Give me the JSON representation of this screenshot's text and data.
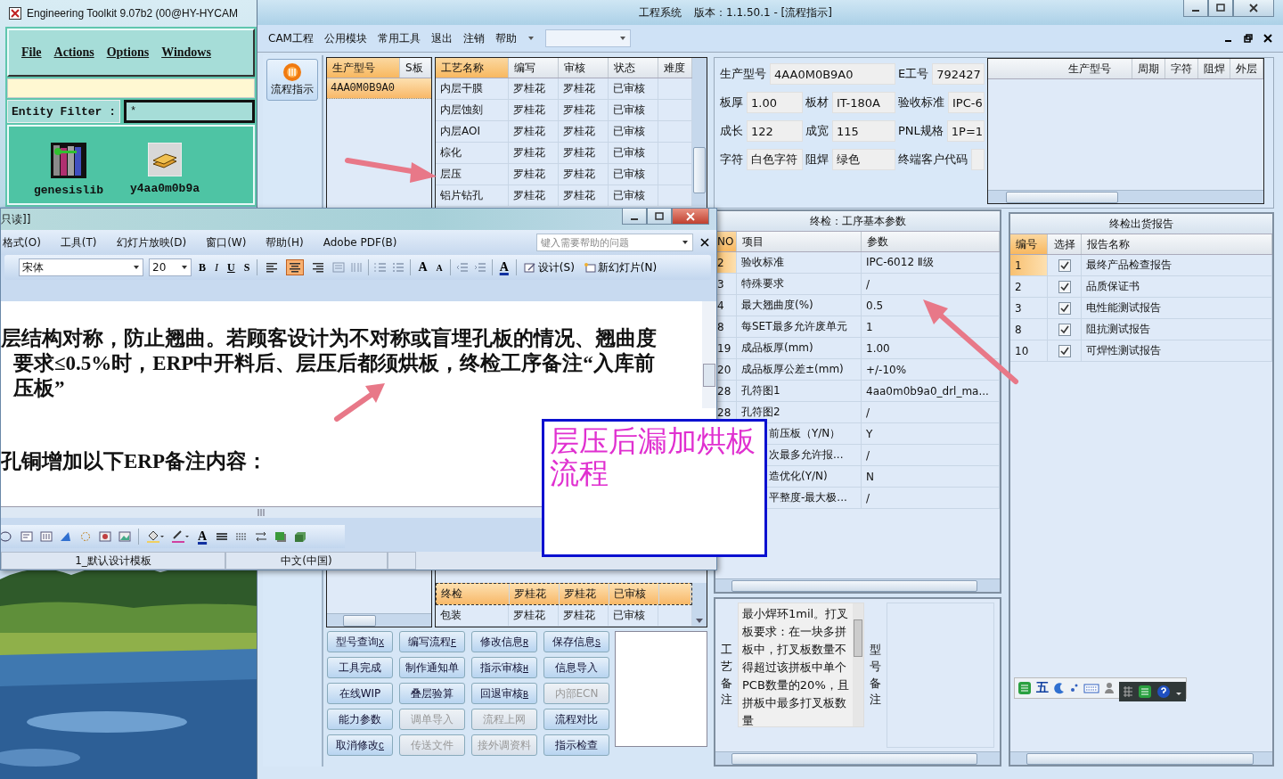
{
  "genesis_window": {
    "title": "Engineering Toolkit 9.07b2 (00@HY-HYCAM",
    "menu": [
      "File",
      "Actions",
      "Options",
      "Windows"
    ],
    "entity_filter": {
      "label": "Entity Filter :",
      "value": "*"
    },
    "entities": [
      {
        "name": "genesislib",
        "kind": "library"
      },
      {
        "name": "y4aa0m0b9a",
        "kind": "job"
      }
    ]
  },
  "main_window": {
    "title": "工程系统",
    "version": "版本：1.1.50.1 - [流程指示]",
    "menu": [
      "CAM工程",
      "公用模块",
      "常用工具",
      "退出",
      "注销",
      "帮助"
    ],
    "nav": [
      {
        "label": "流程指示",
        "selected": true
      }
    ],
    "model_list": {
      "columns": [
        "生产型号",
        "S板"
      ],
      "rows": [
        {
          "model": "4AA0M0B9A0",
          "selected": true
        }
      ]
    },
    "process_table": {
      "columns": [
        "工艺名称",
        "编写",
        "审核",
        "状态",
        "难度"
      ],
      "rows": [
        {
          "name": "内层干膜",
          "writer": "罗桂花",
          "reviewer": "罗桂花",
          "status": "已审核",
          "selected": false
        },
        {
          "name": "内层蚀刻",
          "writer": "罗桂花",
          "reviewer": "罗桂花",
          "status": "已审核",
          "selected": false
        },
        {
          "name": "内层AOI",
          "writer": "罗桂花",
          "reviewer": "罗桂花",
          "status": "已审核",
          "selected": false
        },
        {
          "name": "棕化",
          "writer": "罗桂花",
          "reviewer": "罗桂花",
          "status": "已审核",
          "selected": false
        },
        {
          "name": "层压",
          "writer": "罗桂花",
          "reviewer": "罗桂花",
          "status": "已审核",
          "selected": false
        },
        {
          "name": "铝片钻孔",
          "writer": "罗桂花",
          "reviewer": "罗桂花",
          "status": "已审核",
          "selected": false
        }
      ],
      "rows_lower": [
        {
          "name": "终检",
          "writer": "罗桂花",
          "reviewer": "罗桂花",
          "status": "已审核",
          "selected": true
        },
        {
          "name": "包装",
          "writer": "罗桂花",
          "reviewer": "罗桂花",
          "status": "已审核",
          "selected": false
        }
      ]
    },
    "info": {
      "fields": [
        {
          "kind": "wide",
          "label": "生产型号",
          "value": "4AA0M0B9A0"
        },
        {
          "kind": "normal",
          "label": "E工号",
          "value": "792427"
        },
        {
          "kind": "normal",
          "label": "板厚",
          "value": "1.00"
        },
        {
          "kind": "normal",
          "label": "板材",
          "value": "IT-180A"
        },
        {
          "kind": "normal",
          "label": "验收标准",
          "value": "IPC-6"
        },
        {
          "kind": "normal",
          "label": "成长",
          "value": "122"
        },
        {
          "kind": "normal",
          "label": "成宽",
          "value": "115"
        },
        {
          "kind": "normal",
          "label": "PNL规格",
          "value": "1P=1"
        },
        {
          "kind": "normal",
          "label": "字符",
          "value": "白色字符"
        },
        {
          "kind": "normal",
          "label": "阻焊",
          "value": "绿色"
        },
        {
          "kind": "normal",
          "label": "终端客户代码"
        }
      ]
    },
    "lookup_table": {
      "columns": [
        "生产型号",
        "周期",
        "字符",
        "阻焊",
        "外层"
      ]
    },
    "params": {
      "title": "终检：工序基本参数",
      "columns": [
        "NO",
        "项目",
        "参数"
      ],
      "rows": [
        {
          "no": "2",
          "item": "验收标准",
          "value": "IPC-6012 Ⅱ级",
          "selected": true
        },
        {
          "no": "3",
          "item": "特殊要求",
          "value": "/",
          "selected": false
        },
        {
          "no": "4",
          "item": "最大翘曲度(%)",
          "value": "0.5",
          "selected": false
        },
        {
          "no": "8",
          "item": "每SET最多允许废单元",
          "value": "1",
          "selected": false
        },
        {
          "no": "19",
          "item": "成品板厚(mm)",
          "value": "1.00",
          "selected": false
        },
        {
          "no": "20",
          "item": "成品板厚公差±(mm)",
          "value": "+/-10%",
          "selected": false
        },
        {
          "no": "28",
          "item": "孔符图1",
          "value": "4aa0m0b9a0_drl_ma...",
          "selected": false
        },
        {
          "no": "28",
          "item": "孔符图2",
          "value": "/",
          "selected": false
        },
        {
          "item": "前压板（Y/N）",
          "value": "Y"
        },
        {
          "item": "次最多允许报...",
          "value": "/"
        },
        {
          "item": "造优化(Y/N)",
          "value": "N"
        },
        {
          "item": "平整度-最大极...",
          "value": "/"
        }
      ]
    },
    "report": {
      "title": "终检出货报告",
      "columns": [
        "编号",
        "选择",
        "报告名称"
      ],
      "rows": [
        {
          "no": "1",
          "checked": true,
          "name": "最终产品检查报告",
          "selected": true
        },
        {
          "no": "2",
          "checked": true,
          "name": "品质保证书",
          "selected": false
        },
        {
          "no": "3",
          "checked": true,
          "name": "电性能测试报告",
          "selected": false
        },
        {
          "no": "8",
          "checked": true,
          "name": "阻抗测试报告",
          "selected": false
        },
        {
          "no": "10",
          "checked": true,
          "name": "可焊性测试报告",
          "selected": false
        }
      ]
    },
    "buttons": [
      {
        "label": "型号查询",
        "hotkey": "X",
        "disabled": false
      },
      {
        "label": "编写流程",
        "hotkey": "F",
        "disabled": false
      },
      {
        "label": "修改信息",
        "hotkey": "R",
        "disabled": false
      },
      {
        "label": "保存信息",
        "hotkey": "S",
        "disabled": false
      },
      {
        "label": "工具完成",
        "disabled": false
      },
      {
        "label": "制作通知单",
        "disabled": false
      },
      {
        "label": "指示审核",
        "hotkey": "H",
        "disabled": false
      },
      {
        "label": "信息导入",
        "disabled": false
      },
      {
        "label": "在线WIP",
        "disabled": false
      },
      {
        "label": "叠层验算",
        "disabled": false
      },
      {
        "label": "回退审核",
        "hotkey": "B",
        "disabled": false
      },
      {
        "label": "内部ECN",
        "disabled": true
      },
      {
        "label": "能力参数",
        "disabled": false
      },
      {
        "label": "调单导入",
        "disabled": true
      },
      {
        "label": "流程上网",
        "disabled": true
      },
      {
        "label": "流程对比",
        "disabled": false
      },
      {
        "label": "取消修改",
        "hotkey": "C",
        "disabled": false
      },
      {
        "label": "传送文件",
        "disabled": true
      },
      {
        "label": "接外调资料",
        "disabled": true
      },
      {
        "label": "指示检查",
        "disabled": false
      }
    ],
    "remarks": {
      "process_label": "工艺备注",
      "process_text": "最小焊环1mil。打叉板要求：在一块多拼板中，打叉板数量不得超过该拼板中单个PCB数量的20%，且拼板中最多打叉板数量",
      "model_label": "型号备注"
    }
  },
  "ppt_window": {
    "title": "只读]]",
    "menu": [
      "格式(O)",
      "工具(T)",
      "幻灯片放映(D)",
      "窗口(W)",
      "帮助(H)",
      "Adobe PDF(B)"
    ],
    "help_placeholder": "键入需要帮助的问题",
    "font": "宋体",
    "size": "20",
    "format_buttons": [
      "B",
      "I",
      "U",
      "S"
    ],
    "alignment": [
      {
        "kind": "left",
        "selected": false
      },
      {
        "kind": "center",
        "selected": true
      },
      {
        "kind": "right",
        "selected": false
      }
    ],
    "grow_label": "A",
    "shrink_label": "A",
    "font_color_label": "A",
    "drawing_font_color_label": "A",
    "design_button": "设计(S)",
    "new_slide_button": "新幻灯片(N)",
    "slide": {
      "paragraph": "层结构对称，防止翘曲。若顾客设计为不对称或盲埋孔板的情况、翘曲度要求≤0.5%时，ERP中开料后、层压后都须烘板，终检工序备注“入库前压板”",
      "heading": "孔铜增加以下ERP备注内容："
    },
    "status": [
      "1_默认设计模板",
      "中文(中国)"
    ]
  },
  "callout": {
    "text": "层压后漏加烘板流程"
  },
  "ime_bar": {
    "mode": "五"
  }
}
